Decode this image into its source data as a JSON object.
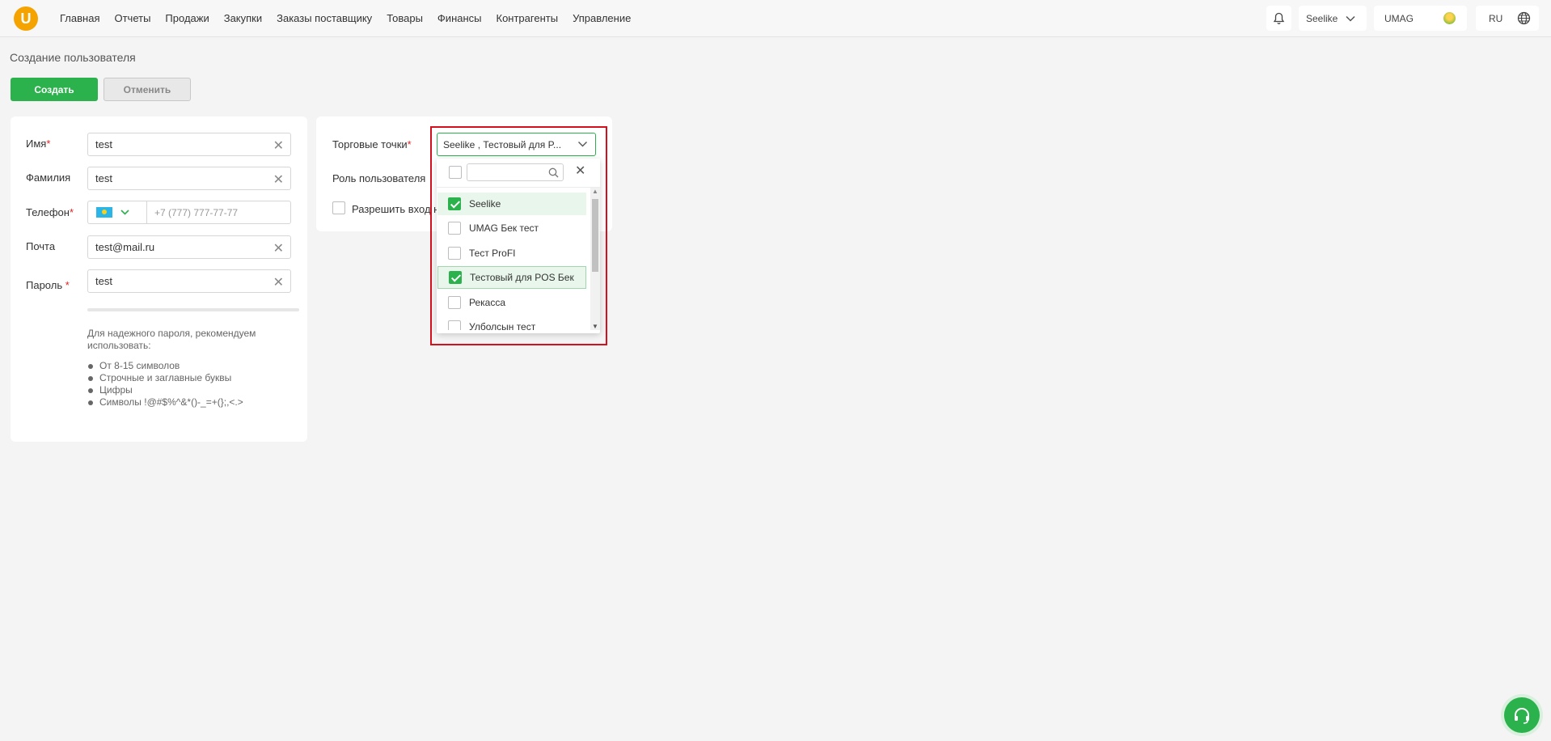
{
  "header": {
    "logo": "U",
    "nav": [
      "Главная",
      "Отчеты",
      "Продажи",
      "Закупки",
      "Заказы поставщику",
      "Товары",
      "Финансы",
      "Контрагенты",
      "Управление"
    ],
    "shop_selector": "Seelike",
    "account": "UMAG",
    "language": "RU"
  },
  "page": {
    "title": "Создание пользователя",
    "create_label": "Создать",
    "cancel_label": "Отменить"
  },
  "form": {
    "first_name": {
      "label": "Имя",
      "required_mark": "*",
      "value": "test"
    },
    "last_name": {
      "label": "Фамилия",
      "value": "test"
    },
    "phone": {
      "label": "Телефон",
      "required_mark": "*",
      "placeholder": "+7 (777) 777-77-77"
    },
    "email": {
      "label": "Почта",
      "value": "test@mail.ru"
    },
    "password": {
      "label": "Пароль",
      "required_mark": "*",
      "value": "test"
    },
    "password_hint": {
      "intro": "Для надежного пароля, рекомендуем использовать:",
      "rules": [
        "От 8-15 символов",
        "Строчные и заглавные буквы",
        "Цифры",
        "Символы !@#$%^&*()-_=+(};,<.>"
      ]
    }
  },
  "right": {
    "shops_label": "Торговые точки",
    "shops_required_mark": "*",
    "shops_value": "Seelike , Тестовый для P...",
    "role_label": "Роль пользователя",
    "allow_login_label": "Разрешить вход н"
  },
  "dropdown": {
    "items": [
      {
        "label": "Seelike",
        "checked": true
      },
      {
        "label": "UMAG Бек тест",
        "checked": false
      },
      {
        "label": "Тест ProFI",
        "checked": false
      },
      {
        "label": "Тестовый для POS Бек",
        "checked": true
      },
      {
        "label": "Рекасса",
        "checked": false
      },
      {
        "label": "Улболсын тест",
        "checked": false
      }
    ]
  },
  "colors": {
    "accent": "#2bb24c",
    "highlight": "#d4101f",
    "logo": "#f5a300"
  }
}
